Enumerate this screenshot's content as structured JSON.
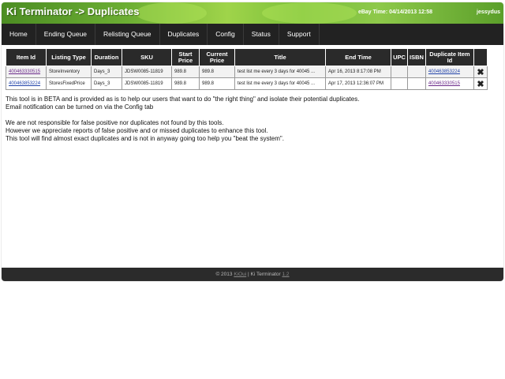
{
  "header": {
    "title": "Ki Terminator -> Duplicates",
    "ebay_time": "eBay Time: 04/14/2013 12:58",
    "user": "jessydus"
  },
  "nav": [
    "Home",
    "Ending Queue",
    "Relisting Queue",
    "Duplicates",
    "Config",
    "Status",
    "Support"
  ],
  "table": {
    "headers": [
      "Item Id",
      "Listing Type",
      "Duration",
      "SKU",
      "Start Price",
      "Current Price",
      "Title",
      "End Time",
      "UPC",
      "ISBN",
      "Duplicate Item Id",
      ""
    ],
    "rows": [
      {
        "item_id": "400463330515",
        "listing_type": "StoreInventory",
        "duration": "Days_3",
        "sku": "JDSW0085-11819",
        "start_price": "989.8",
        "current_price": "989.8",
        "title": "test list me every 3 days for 40045 ...",
        "end_time": "Apr 16, 2013 8:17:08 PM",
        "upc": "",
        "isbn": "",
        "duplicate_item_id": "400463853224",
        "delete": "✖"
      },
      {
        "item_id": "400463853224",
        "listing_type": "StoresFixedPrice",
        "duration": "Days_3",
        "sku": "JDSW0085-11819",
        "start_price": "989.8",
        "current_price": "989.8",
        "title": "test list me every 3 days for 40045 ...",
        "end_time": "Apr 17, 2013 12:36:07 PM",
        "upc": "",
        "isbn": "",
        "duplicate_item_id": "400463330515",
        "delete": "✖"
      }
    ]
  },
  "messages": {
    "line1": "This tool is in BETA and is provided as is to help our users that want to do \"the right thing\" and isolate their potential duplicates.",
    "line2": "Email notification can be turned on via the Config tab",
    "line3": "We are not responsible for false positive nor duplicates not found by this tools.",
    "line4": "However we appreciate reports of false positive and or missed duplicates to enhance this tool.",
    "line5": "This tool will find almost exact duplicates and is not in anyway going too help you \"beat the system\"."
  },
  "footer": {
    "prefix": "© 2013",
    "company": "KiOui",
    "sep": "| Ki Terminator",
    "version": "1.2"
  },
  "colors": {
    "header_green": "#6cae33",
    "nav_bg": "#222222",
    "delete_red": "#cc1111"
  }
}
